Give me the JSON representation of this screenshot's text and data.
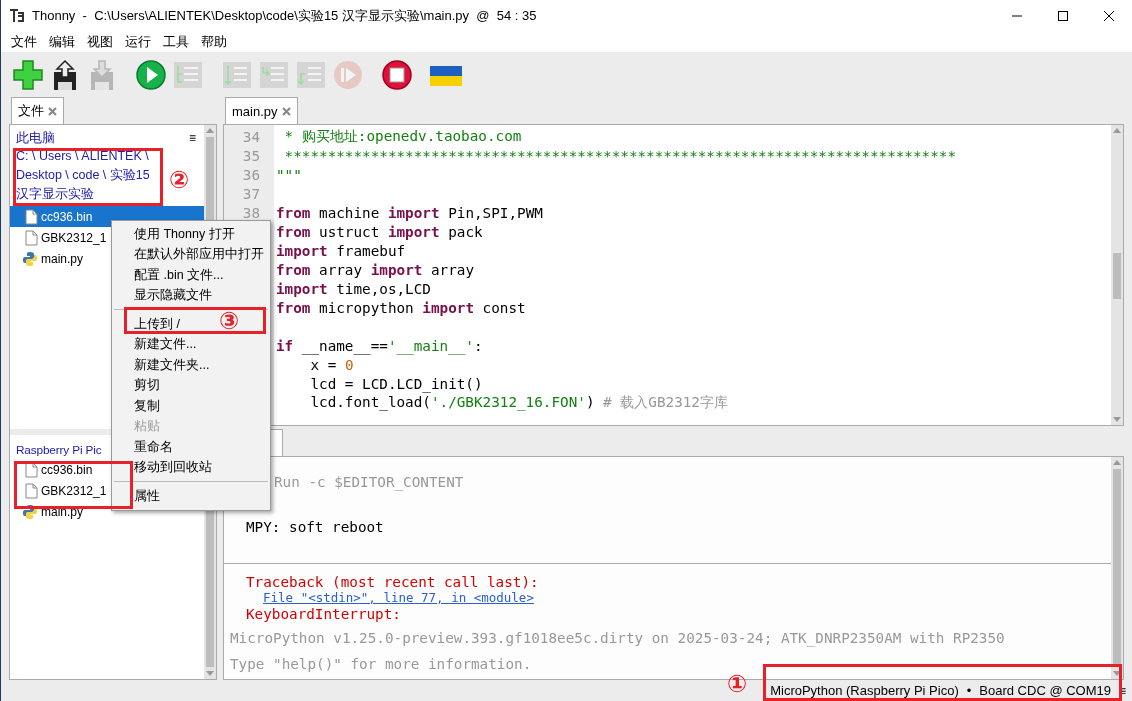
{
  "window": {
    "title": "Thonny  -  C:\\Users\\ALIENTEK\\Desktop\\code\\实验15 汉字显示实验\\main.py  @  54 : 35"
  },
  "menu": [
    "文件",
    "编辑",
    "视图",
    "运行",
    "工具",
    "帮助"
  ],
  "toolbar": [
    {
      "kind": "new",
      "disabled": false
    },
    {
      "kind": "load",
      "disabled": false
    },
    {
      "kind": "save",
      "disabled": true
    },
    {
      "kind": "run",
      "disabled": false
    },
    {
      "kind": "debug",
      "disabled": true
    },
    {
      "kind": "step_over",
      "disabled": true
    },
    {
      "kind": "step_into",
      "disabled": true
    },
    {
      "kind": "step_out",
      "disabled": true
    },
    {
      "kind": "resume",
      "disabled": true
    },
    {
      "kind": "stop",
      "disabled": false
    },
    {
      "kind": "flag",
      "disabled": false
    }
  ],
  "files_panel": {
    "tab": {
      "label": "文件",
      "selected": true
    },
    "menu_glyph": "≡",
    "local": {
      "root": "此电脑",
      "path": "C: \\ Users \\ ALIENTEK \\ Desktop \\ code \\ 实验15 汉字显示实验",
      "items": [
        {
          "name": "cc936.bin",
          "kind": "file",
          "selected": true
        },
        {
          "name": "GBK2312_1",
          "kind": "file",
          "selected": false
        },
        {
          "name": "main.py",
          "kind": "python",
          "selected": false
        }
      ]
    },
    "device": {
      "root": "Raspberry Pi Pic",
      "items": [
        {
          "name": "cc936.bin",
          "kind": "file",
          "selected": false
        },
        {
          "name": "GBK2312_1",
          "kind": "file",
          "selected": false
        },
        {
          "name": "main.py",
          "kind": "python",
          "selected": false
        }
      ]
    }
  },
  "editor": {
    "tab": {
      "label": "main.py",
      "selected": true
    },
    "lines": [
      {
        "number": "34",
        "kind": "code",
        "segments": [
          {
            "kind": "string",
            "text": " * 购买地址:openedv.taobao.com"
          }
        ]
      },
      {
        "number": "35",
        "kind": "code",
        "segments": [
          {
            "kind": "string",
            "text": " ******************************************************************************"
          }
        ]
      },
      {
        "number": "36",
        "kind": "code",
        "segments": [
          {
            "kind": "string",
            "text": "\"\"\""
          }
        ]
      },
      {
        "number": "37",
        "kind": "blank"
      },
      {
        "number": "38",
        "kind": "code",
        "segments": [
          {
            "kind": "keyword",
            "text": "from"
          },
          {
            "kind": "plain",
            "text": " machine "
          },
          {
            "kind": "keyword",
            "text": "import"
          },
          {
            "kind": "plain",
            "text": " Pin,SPI,PWM"
          }
        ]
      },
      {
        "kind": "code",
        "segments": [
          {
            "kind": "keyword",
            "text": "from"
          },
          {
            "kind": "plain",
            "text": " ustruct "
          },
          {
            "kind": "keyword",
            "text": "import"
          },
          {
            "kind": "plain",
            "text": " pack"
          }
        ]
      },
      {
        "kind": "code",
        "segments": [
          {
            "kind": "keyword",
            "text": "import"
          },
          {
            "kind": "plain",
            "text": " framebuf"
          }
        ]
      },
      {
        "kind": "code",
        "segments": [
          {
            "kind": "keyword",
            "text": "from"
          },
          {
            "kind": "plain",
            "text": " array "
          },
          {
            "kind": "keyword",
            "text": "import"
          },
          {
            "kind": "plain",
            "text": " array"
          }
        ]
      },
      {
        "kind": "code",
        "segments": [
          {
            "kind": "keyword",
            "text": "import"
          },
          {
            "kind": "plain",
            "text": " time,os,LCD"
          }
        ]
      },
      {
        "kind": "code",
        "segments": [
          {
            "kind": "keyword",
            "text": "from"
          },
          {
            "kind": "plain",
            "text": " micropython "
          },
          {
            "kind": "keyword",
            "text": "import"
          },
          {
            "kind": "plain",
            "text": " const"
          }
        ]
      },
      {
        "kind": "blank"
      },
      {
        "kind": "code",
        "segments": [
          {
            "kind": "keyword",
            "text": "if"
          },
          {
            "kind": "plain",
            "text": " __name__=="
          },
          {
            "kind": "string",
            "text": "'__main__'"
          },
          {
            "kind": "plain",
            "text": ":"
          }
        ]
      },
      {
        "kind": "code",
        "segments": [
          {
            "kind": "plain",
            "text": "    x = "
          },
          {
            "kind": "number",
            "text": "0"
          }
        ]
      },
      {
        "kind": "code",
        "segments": [
          {
            "kind": "plain",
            "text": "    lcd = LCD.LCD_init()"
          }
        ]
      },
      {
        "kind": "code",
        "segments": [
          {
            "kind": "plain",
            "text": "    lcd.font_load("
          },
          {
            "kind": "string",
            "text": "'./GBK2312_16.FON'"
          },
          {
            "kind": "plain",
            "text": ") "
          },
          {
            "kind": "comment",
            "text": "# 载入GB2312字库"
          }
        ]
      }
    ]
  },
  "shell": {
    "tab": {
      "selected": true
    },
    "lines": [
      {
        "kind": "command",
        "text": "Run -c $EDITOR_CONTENT"
      },
      {
        "kind": "output",
        "text": "MPY: soft reboot"
      },
      {
        "kind": "separator"
      },
      {
        "kind": "error",
        "text": "Traceback (most recent call last):"
      },
      {
        "kind": "link",
        "text": "File \"<stdin>\", line 77, in <module>"
      },
      {
        "kind": "error",
        "text": "KeyboardInterrupt:"
      },
      {
        "kind": "info",
        "text": "MicroPython v1.25.0-preview.393.gf1018ee5c.dirty on 2025-03-24; ATK_DNRP2350AM with RP2350"
      },
      {
        "kind": "info",
        "text": "Type \"help()\" for more information."
      }
    ]
  },
  "context_menu": [
    {
      "kind": "item",
      "label": "使用 Thonny 打开",
      "disabled": false
    },
    {
      "kind": "item",
      "label": "在默认外部应用中打开",
      "disabled": false
    },
    {
      "kind": "item",
      "label": "配置 .bin 文件...",
      "disabled": false
    },
    {
      "kind": "item",
      "label": "显示隐藏文件",
      "disabled": false
    },
    {
      "kind": "separator"
    },
    {
      "kind": "item",
      "label": "上传到 /",
      "disabled": false
    },
    {
      "kind": "item",
      "label": "新建文件...",
      "disabled": false
    },
    {
      "kind": "item",
      "label": "新建文件夹...",
      "disabled": false
    },
    {
      "kind": "item",
      "label": "剪切",
      "disabled": false
    },
    {
      "kind": "item",
      "label": "复制",
      "disabled": false
    },
    {
      "kind": "item",
      "label": "粘贴",
      "disabled": true
    },
    {
      "kind": "item",
      "label": "重命名",
      "disabled": false
    },
    {
      "kind": "item",
      "label": "移动到回收站",
      "disabled": false
    },
    {
      "kind": "separator"
    },
    {
      "kind": "item",
      "label": "属性",
      "disabled": false
    }
  ],
  "status_bar": {
    "interpreter": "MicroPython (Raspberry Pi Pico)",
    "separator": "•",
    "port": "Board CDC @ COM19",
    "menu_glyph": "≡"
  },
  "annotations": [
    {
      "kind": "numbered",
      "label": "②"
    },
    {
      "kind": "numbered",
      "label": "③"
    },
    {
      "kind": "box"
    },
    {
      "kind": "numbered",
      "label": "①"
    }
  ]
}
